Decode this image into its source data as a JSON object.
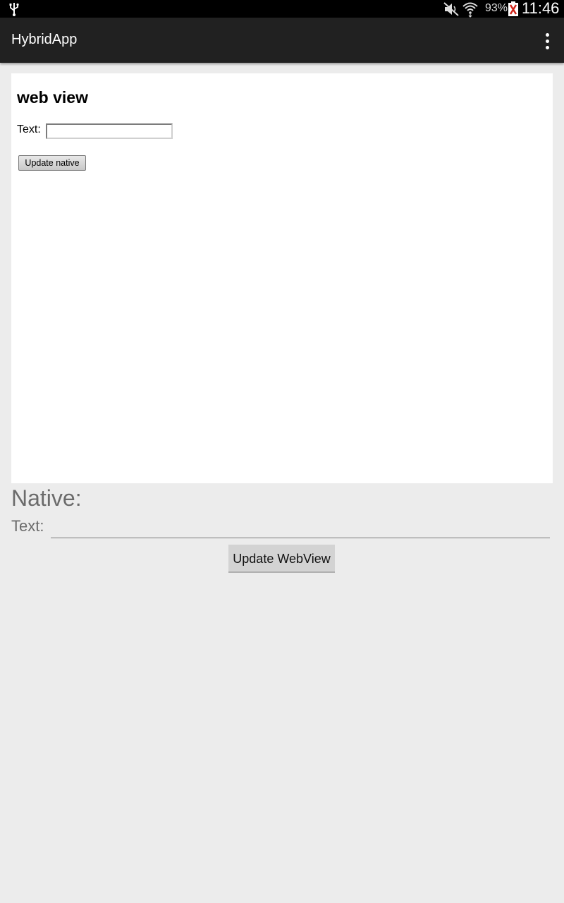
{
  "status_bar": {
    "battery_percent": "93%",
    "time": "11:46",
    "icons": [
      "usb-icon",
      "mute-icon",
      "wifi-icon",
      "battery-icon"
    ]
  },
  "action_bar": {
    "title": "HybridApp",
    "overflow_icon": "overflow-menu-icon"
  },
  "webview": {
    "heading": "web view",
    "text_label": "Text:",
    "input_value": "",
    "button_label": "Update native"
  },
  "native": {
    "title": "Native:",
    "text_label": "Text:",
    "input_value": "",
    "button_label": "Update WebView"
  },
  "colors": {
    "status_bar": "#000000",
    "action_bar": "#212121",
    "background": "#ececec",
    "webview_background": "#ffffff",
    "native_text": "#6b6b6b"
  }
}
